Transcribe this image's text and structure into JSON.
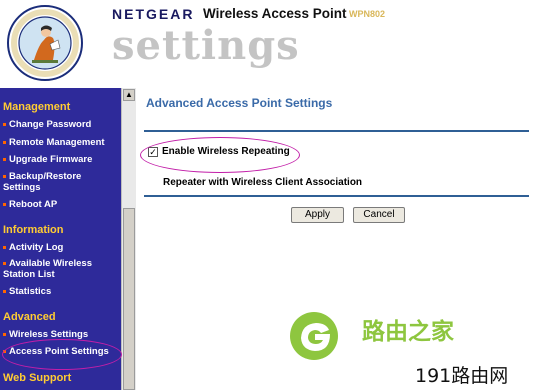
{
  "header": {
    "brand": "NETGEAR",
    "product": "Wireless Access Point",
    "model": "WPN802",
    "settings_word": "settings",
    "seal_text": "HUBS · SWITCHES · WIRELESS · ROUTERS · ADAPTERS"
  },
  "sidebar": {
    "sections": [
      {
        "heading": "Management",
        "items": [
          {
            "label": "Change Password"
          },
          {
            "label": "Remote Management"
          },
          {
            "label": "Upgrade Firmware"
          },
          {
            "label": "Backup/Restore Settings"
          },
          {
            "label": "Reboot AP"
          }
        ]
      },
      {
        "heading": "Information",
        "items": [
          {
            "label": "Activity Log"
          },
          {
            "label": "Available Wireless Station List"
          },
          {
            "label": "Statistics"
          }
        ]
      },
      {
        "heading": "Advanced",
        "items": [
          {
            "label": "Wireless Settings"
          },
          {
            "label": "Access Point Settings",
            "selected": true
          }
        ]
      },
      {
        "heading": "Web Support",
        "items": []
      }
    ]
  },
  "main": {
    "title": "Advanced Access Point Settings",
    "checkbox_label": "Enable Wireless Repeating",
    "checkbox_checked": true,
    "sub_label": "Repeater with Wireless Client Association",
    "apply_label": "Apply",
    "cancel_label": "Cancel"
  },
  "watermark": {
    "cn_name": "路由之家",
    "url": "191路由网"
  },
  "colors": {
    "sidebar_bg": "#2e2a9a",
    "heading": "#ffcc33",
    "title": "#3a6aa8",
    "rule": "#2f5f95",
    "highlight": "#c21ea8",
    "watermark_green": "#8ec63f"
  }
}
